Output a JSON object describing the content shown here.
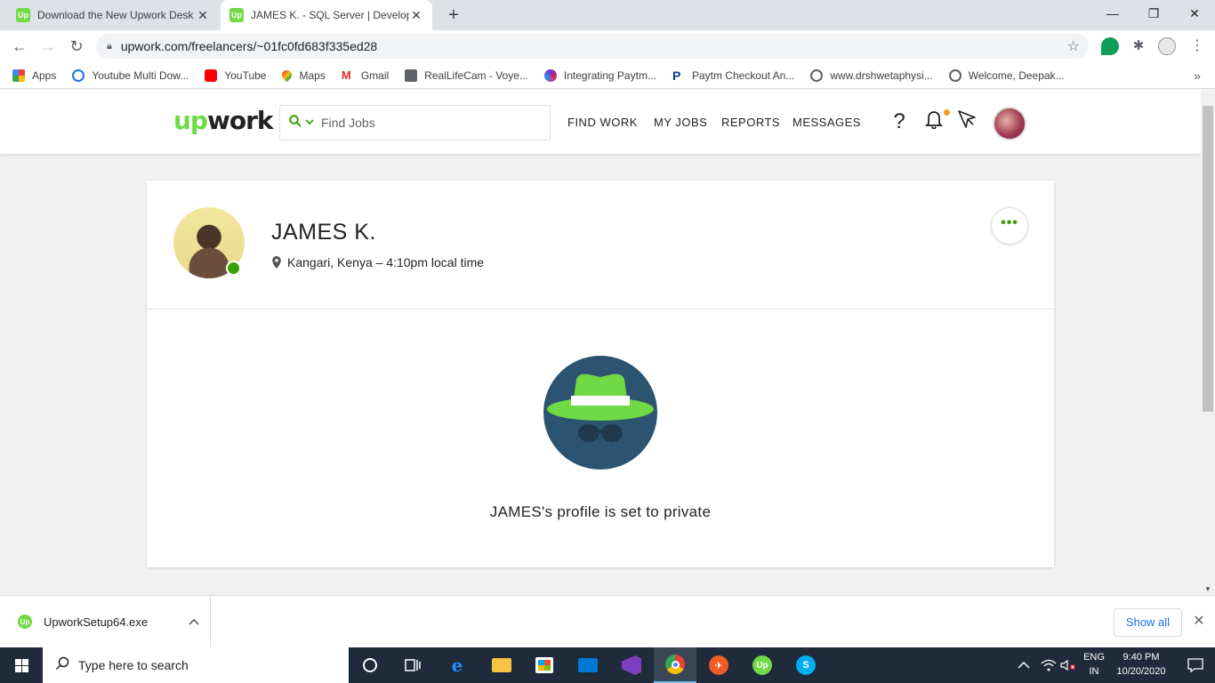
{
  "browser": {
    "tabs": [
      {
        "title": "Download the New Upwork Desk",
        "favicon": "Up",
        "active": false
      },
      {
        "title": "JAMES K. - SQL Server | Developr",
        "favicon": "Up",
        "active": true
      }
    ],
    "new_tab_label": "+",
    "url": "upwork.com/freelancers/~01fc0fd683f335ed28",
    "bookmarks": [
      {
        "label": "Apps",
        "icon": "apps-grid-icon",
        "color": "#4285f4"
      },
      {
        "label": "Youtube Multi Dow...",
        "icon": "globe-icon",
        "color": "#1a73e8"
      },
      {
        "label": "YouTube",
        "icon": "youtube-icon",
        "color": "#ff0000"
      },
      {
        "label": "Maps",
        "icon": "maps-icon",
        "color": "#34a853"
      },
      {
        "label": "Gmail",
        "icon": "gmail-icon",
        "color": "#d93025"
      },
      {
        "label": "RealLifeCam - Voye...",
        "icon": "reallifecam-icon",
        "color": "#5f6368"
      },
      {
        "label": "Integrating Paytm...",
        "icon": "paytm-icon",
        "color": "#7b2fbf"
      },
      {
        "label": "Paytm Checkout An...",
        "icon": "paytm-p-icon",
        "color": "#0b3d91"
      },
      {
        "label": "www.drshwetaphysi...",
        "icon": "globe-icon",
        "color": "#5f6368"
      },
      {
        "label": "Welcome, Deepak...",
        "icon": "globe-icon",
        "color": "#5f6368"
      }
    ]
  },
  "upwork": {
    "logo_up": "up",
    "logo_work": "work",
    "search_placeholder": "Find Jobs",
    "nav": [
      "FIND WORK",
      "MY JOBS",
      "REPORTS",
      "MESSAGES"
    ],
    "help_label": "?"
  },
  "profile": {
    "name": "JAMES K.",
    "location": "Kangari, Kenya – 4:10pm local time",
    "more_label": "•••",
    "private_message": "JAMES's profile is set to private"
  },
  "downloads": {
    "file": "UpworkSetup64.exe",
    "show_all": "Show all"
  },
  "taskbar": {
    "search_placeholder": "Type here to search",
    "lang_line1": "ENG",
    "lang_line2": "IN",
    "time": "9:40 PM",
    "date": "10/20/2020"
  },
  "colors": {
    "upwork_green": "#6fda44",
    "upwork_dark_green": "#37a000",
    "notification_dot": "#f1a01e",
    "spy_bg": "#2c5470",
    "spy_hat": "#6fda44"
  }
}
